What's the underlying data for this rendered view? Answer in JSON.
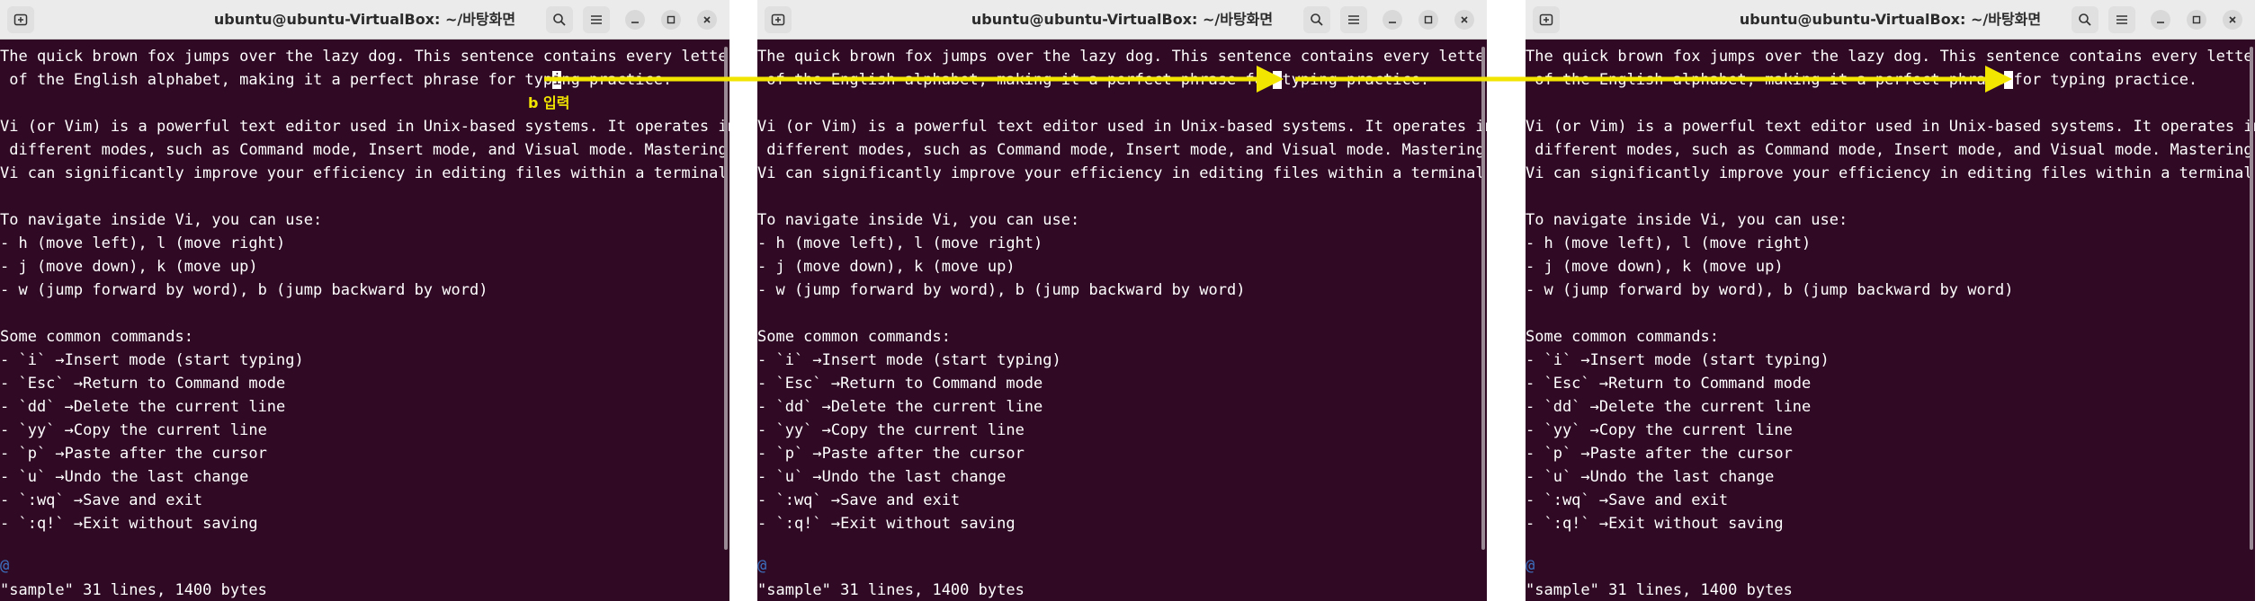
{
  "window": {
    "title": "ubuntu@ubuntu-VirtualBox: ~/바탕화면",
    "buttons": {
      "new_tab_icon": "new-tab-icon",
      "search_icon": "search-icon",
      "menu_icon": "hamburger-menu-icon",
      "minimize_icon": "minimize-icon",
      "maximize_icon": "maximize-icon",
      "close_icon": "close-icon"
    }
  },
  "editor": {
    "lines": [
      "The quick brown fox jumps over the lazy dog. This sentence contains every letter",
      " of the English alphabet, making it a perfect phrase for typing practice.",
      "",
      "Vi (or Vim) is a powerful text editor used in Unix-based systems. It operates in",
      " different modes, such as Command mode, Insert mode, and Visual mode. Mastering",
      "Vi can significantly improve your efficiency in editing files within a terminal.",
      "",
      "To navigate inside Vi, you can use:",
      "- h (move left), l (move right)",
      "- j (move down), k (move up)",
      "- w (jump forward by word), b (jump backward by word)",
      "",
      "Some common commands:",
      "- `i` →Insert mode (start typing)",
      "- `Esc` →Return to Command mode",
      "- `dd` →Delete the current line",
      "- `yy` →Copy the current line",
      "- `p` →Paste after the cursor",
      "- `u` →Undo the last change",
      "- `:wq` →Save and exit",
      "- `:q!` →Exit without saving"
    ],
    "tilde": "@",
    "status": "\"sample\" 31 lines, 1400 bytes"
  },
  "panels": [
    {
      "cursor_line": 1,
      "cursor_col": 60,
      "cursor_char": "i"
    },
    {
      "cursor_line": 1,
      "cursor_col": 56,
      "cursor_char": "t"
    },
    {
      "cursor_line": 1,
      "cursor_col": 52,
      "cursor_char": "f"
    }
  ],
  "annotation": {
    "label": "b 입력",
    "color": "#f2e600"
  }
}
